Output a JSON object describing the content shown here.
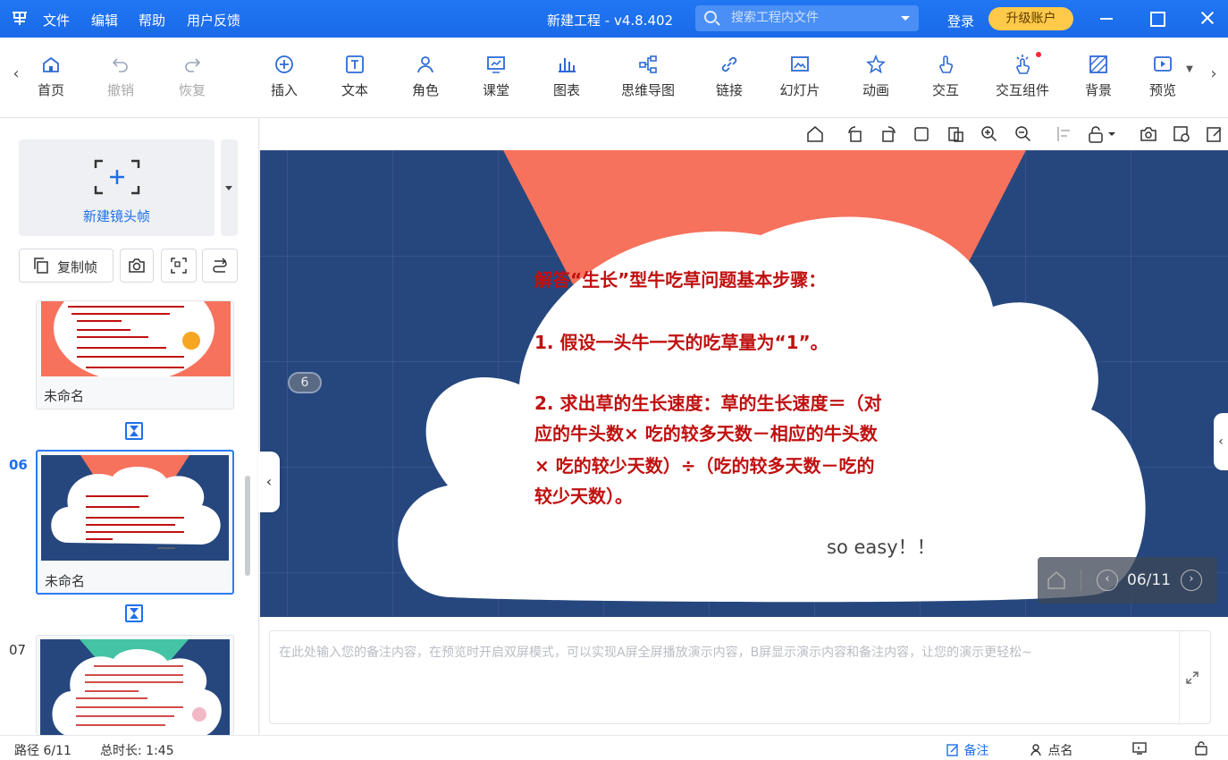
{
  "titlebar": {
    "menu": [
      "文件",
      "编辑",
      "帮助",
      "用户反馈"
    ],
    "window_title": "新建工程 - v4.8.402",
    "search_placeholder": "搜索工程内文件",
    "login": "登录",
    "upgrade": "升级账户"
  },
  "toolbar": {
    "items": [
      {
        "label": "首页",
        "icon": "home-icon"
      },
      {
        "label": "撤销",
        "icon": "undo-icon"
      },
      {
        "label": "恢复",
        "icon": "redo-icon"
      },
      {
        "label": "插入",
        "icon": "plus-circle-icon"
      },
      {
        "label": "文本",
        "icon": "text-icon"
      },
      {
        "label": "角色",
        "icon": "role-icon"
      },
      {
        "label": "课堂",
        "icon": "classroom-icon"
      },
      {
        "label": "图表",
        "icon": "chart-icon"
      },
      {
        "label": "思维导图",
        "icon": "mindmap-icon"
      },
      {
        "label": "链接",
        "icon": "link-icon"
      },
      {
        "label": "幻灯片",
        "icon": "slides-icon"
      },
      {
        "label": "动画",
        "icon": "animation-icon"
      },
      {
        "label": "交互",
        "icon": "interaction-icon"
      },
      {
        "label": "交互组件",
        "icon": "interaction-component-icon"
      },
      {
        "label": "背景",
        "icon": "background-icon"
      },
      {
        "label": "预览",
        "icon": "preview-icon"
      }
    ]
  },
  "left_panel": {
    "new_frame_label": "新建镜头帧",
    "copy_frame_label": "复制帧",
    "frames": [
      {
        "number": "",
        "name": "未命名"
      },
      {
        "number": "06",
        "name": "未命名"
      },
      {
        "number": "07",
        "name": ""
      }
    ]
  },
  "slide": {
    "heading": "解答“生长”型牛吃草问题基本步骤：",
    "step1": "1. 假设一头牛一天的吃草量为“1”。",
    "step2_lines": [
      "2. 求出草的生长速度：草的生长速度＝（对",
      "应的牛头数× 吃的较多天数－相应的牛头数",
      "× 吃的较少天数）÷（吃的较多天数－吃的",
      "较少天数）。"
    ],
    "footer_text": "so easy！！",
    "path_badge": "6",
    "page_indicator": "06/11",
    "colors": {
      "background": "#26477e",
      "cloud": "#ffffff",
      "triangle": "#f6725d",
      "text": "#c01010"
    }
  },
  "notes": {
    "placeholder": "在此处输入您的备注内容，在预览时开启双屏模式，可以实现A屏全屏播放演示内容，B屏显示演示内容和备注内容，让您的演示更轻松~"
  },
  "statusbar": {
    "path": "路径 6/11",
    "duration": "总时长: 1:45",
    "notes": "备注",
    "rollcall": "点名"
  }
}
